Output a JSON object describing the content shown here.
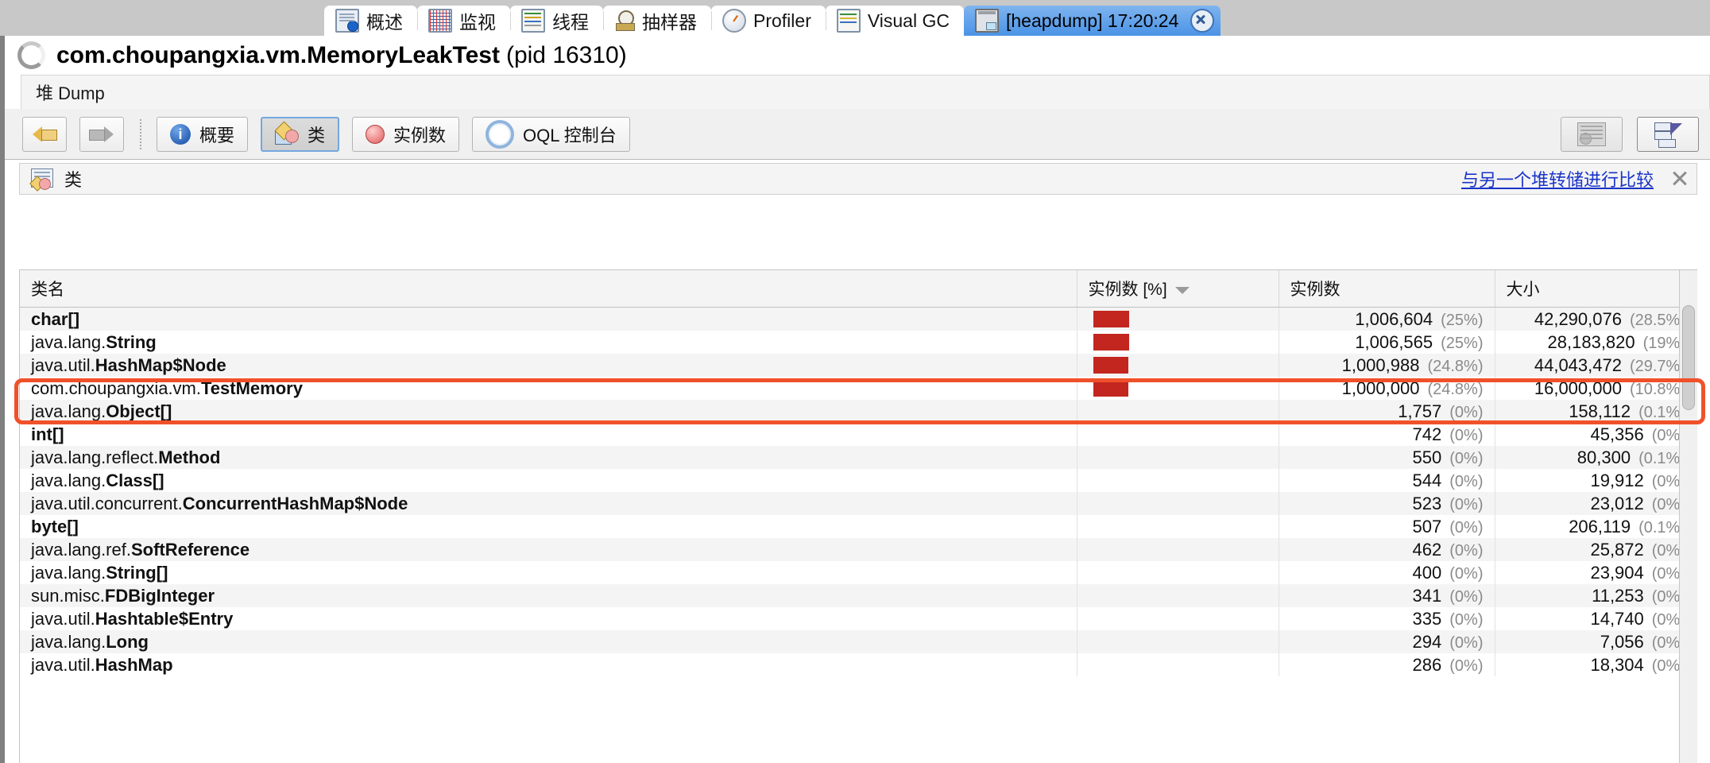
{
  "tabs": [
    {
      "label": "概述",
      "icon": "overview-icon",
      "active": false
    },
    {
      "label": "监视",
      "icon": "monitor-icon",
      "active": false
    },
    {
      "label": "线程",
      "icon": "threads-icon",
      "active": false
    },
    {
      "label": "抽样器",
      "icon": "sampler-icon",
      "active": false
    },
    {
      "label": "Profiler",
      "icon": "profiler-clock-icon",
      "active": false
    },
    {
      "label": "Visual GC",
      "icon": "visual-gc-icon",
      "active": false
    },
    {
      "label": "[heapdump] 17:20:24",
      "icon": "heapdump-icon",
      "active": true
    }
  ],
  "app": {
    "title_main": "com.choupangxia.vm.MemoryLeakTest",
    "title_pid": "(pid 16310)",
    "subtab": "堆 Dump"
  },
  "toolbar": {
    "back": "",
    "forward": "",
    "summary": "概要",
    "classes": "类",
    "instances": "实例数",
    "oql": "OQL 控制台",
    "report": "",
    "export": ""
  },
  "classbar": {
    "label": "类",
    "compare_link": "与另一个堆转储进行比较"
  },
  "table": {
    "columns": [
      "类名",
      "实例数 [%]",
      "实例数",
      "大小"
    ],
    "sorted_column": "实例数 [%]",
    "sort_direction": "desc",
    "bar_color": "#c2261f",
    "rows": [
      {
        "pkg": "",
        "name": "char[]",
        "bar": 100,
        "count": "1,006,604",
        "count_pct": "(25%)",
        "size": "42,290,076",
        "size_pct": "(28.5%)"
      },
      {
        "pkg": "java.lang.",
        "name": "String",
        "bar": 100,
        "count": "1,006,565",
        "count_pct": "(25%)",
        "size": "28,183,820",
        "size_pct": "(19%)"
      },
      {
        "pkg": "java.util.",
        "name": "HashMap$Node",
        "bar": 99,
        "count": "1,000,988",
        "count_pct": "(24.8%)",
        "size": "44,043,472",
        "size_pct": "(29.7%)"
      },
      {
        "pkg": "com.choupangxia.vm.",
        "name": "TestMemory",
        "bar": 99,
        "count": "1,000,000",
        "count_pct": "(24.8%)",
        "size": "16,000,000",
        "size_pct": "(10.8%)"
      },
      {
        "pkg": "java.lang.",
        "name": "Object[]",
        "bar": 0,
        "count": "1,757",
        "count_pct": "(0%)",
        "size": "158,112",
        "size_pct": "(0.1%)"
      },
      {
        "pkg": "",
        "name": "int[]",
        "bar": 0,
        "count": "742",
        "count_pct": "(0%)",
        "size": "45,356",
        "size_pct": "(0%)"
      },
      {
        "pkg": "java.lang.reflect.",
        "name": "Method",
        "bar": 0,
        "count": "550",
        "count_pct": "(0%)",
        "size": "80,300",
        "size_pct": "(0.1%)"
      },
      {
        "pkg": "java.lang.",
        "name": "Class[]",
        "bar": 0,
        "count": "544",
        "count_pct": "(0%)",
        "size": "19,912",
        "size_pct": "(0%)"
      },
      {
        "pkg": "java.util.concurrent.",
        "name": "ConcurrentHashMap$Node",
        "bar": 0,
        "count": "523",
        "count_pct": "(0%)",
        "size": "23,012",
        "size_pct": "(0%)"
      },
      {
        "pkg": "",
        "name": "byte[]",
        "bar": 0,
        "count": "507",
        "count_pct": "(0%)",
        "size": "206,119",
        "size_pct": "(0.1%)"
      },
      {
        "pkg": "java.lang.ref.",
        "name": "SoftReference",
        "bar": 0,
        "count": "462",
        "count_pct": "(0%)",
        "size": "25,872",
        "size_pct": "(0%)"
      },
      {
        "pkg": "java.lang.",
        "name": "String[]",
        "bar": 0,
        "count": "400",
        "count_pct": "(0%)",
        "size": "23,904",
        "size_pct": "(0%)"
      },
      {
        "pkg": "sun.misc.",
        "name": "FDBigInteger",
        "bar": 0,
        "count": "341",
        "count_pct": "(0%)",
        "size": "11,253",
        "size_pct": "(0%)"
      },
      {
        "pkg": "java.util.",
        "name": "Hashtable$Entry",
        "bar": 0,
        "count": "335",
        "count_pct": "(0%)",
        "size": "14,740",
        "size_pct": "(0%)"
      },
      {
        "pkg": "java.lang.",
        "name": "Long",
        "bar": 0,
        "count": "294",
        "count_pct": "(0%)",
        "size": "7,056",
        "size_pct": "(0%)"
      },
      {
        "pkg": "java.util.",
        "name": "HashMap",
        "bar": 0,
        "count": "286",
        "count_pct": "(0%)",
        "size": "18,304",
        "size_pct": "(0%)"
      }
    ],
    "highlighted_row_index": 3,
    "highlight_color": "#f0512a"
  }
}
